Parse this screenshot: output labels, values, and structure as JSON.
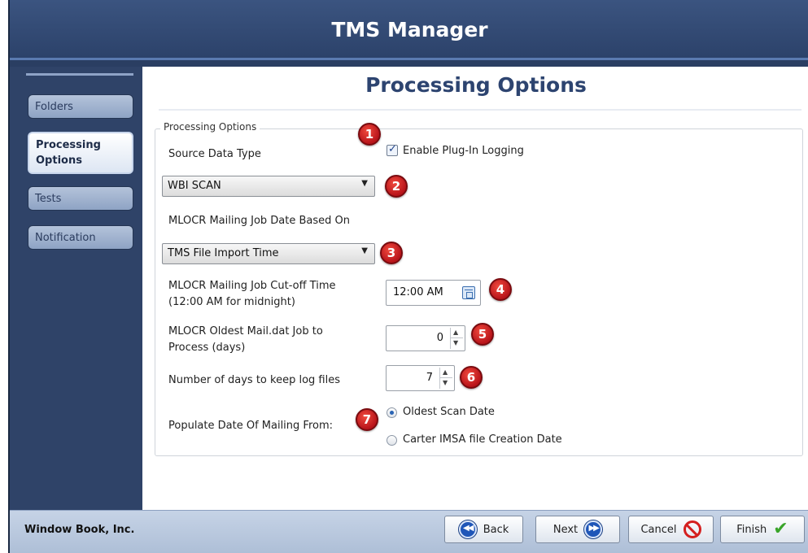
{
  "app": {
    "title": "TMS Manager"
  },
  "sidebar": {
    "items": [
      {
        "label": "Folders"
      },
      {
        "label": "Processing Options"
      },
      {
        "label": "Tests"
      },
      {
        "label": "Notification"
      }
    ]
  },
  "page": {
    "title": "Processing Options"
  },
  "group": {
    "legend": "Processing Options"
  },
  "form": {
    "source_data_type_label": "Source Data Type",
    "enable_logging_label": "Enable Plug-In Logging",
    "enable_logging_checked": true,
    "source_data_type_value": "WBI SCAN",
    "job_date_label": "MLOCR Mailing Job Date Based On",
    "job_date_value": "TMS File Import Time",
    "cutoff_label_line1": "MLOCR Mailing Job Cut-off Time",
    "cutoff_label_line2": "(12:00 AM for midnight)",
    "cutoff_value": "12:00 AM",
    "oldest_job_label_line1": "MLOCR Oldest Mail.dat Job to",
    "oldest_job_label_line2": "Process (days)",
    "oldest_job_value": "0",
    "log_days_label": "Number of days to keep log files",
    "log_days_value": "7",
    "populate_label": "Populate Date Of Mailing From:",
    "radio_options": [
      {
        "label": "Oldest Scan Date",
        "selected": true
      },
      {
        "label": "Carter IMSA file Creation Date",
        "selected": false
      }
    ]
  },
  "badges": [
    "1",
    "2",
    "3",
    "4",
    "5",
    "6",
    "7"
  ],
  "footer": {
    "company": "Window Book, Inc.",
    "back_label": "Back",
    "next_label": "Next",
    "cancel_label": "Cancel",
    "finish_label": "Finish"
  },
  "icons": {
    "back": "back-arrow-icon",
    "next": "next-arrow-icon",
    "cancel": "cancel-icon",
    "finish": "checkmark-icon",
    "calendar": "calendar-icon"
  },
  "colors": {
    "title_bar": "#2e4366",
    "page_title": "#2d4470",
    "badge": "#d41f1f",
    "accent_blue": "#1f56b8",
    "check_green": "#3aa52a"
  }
}
